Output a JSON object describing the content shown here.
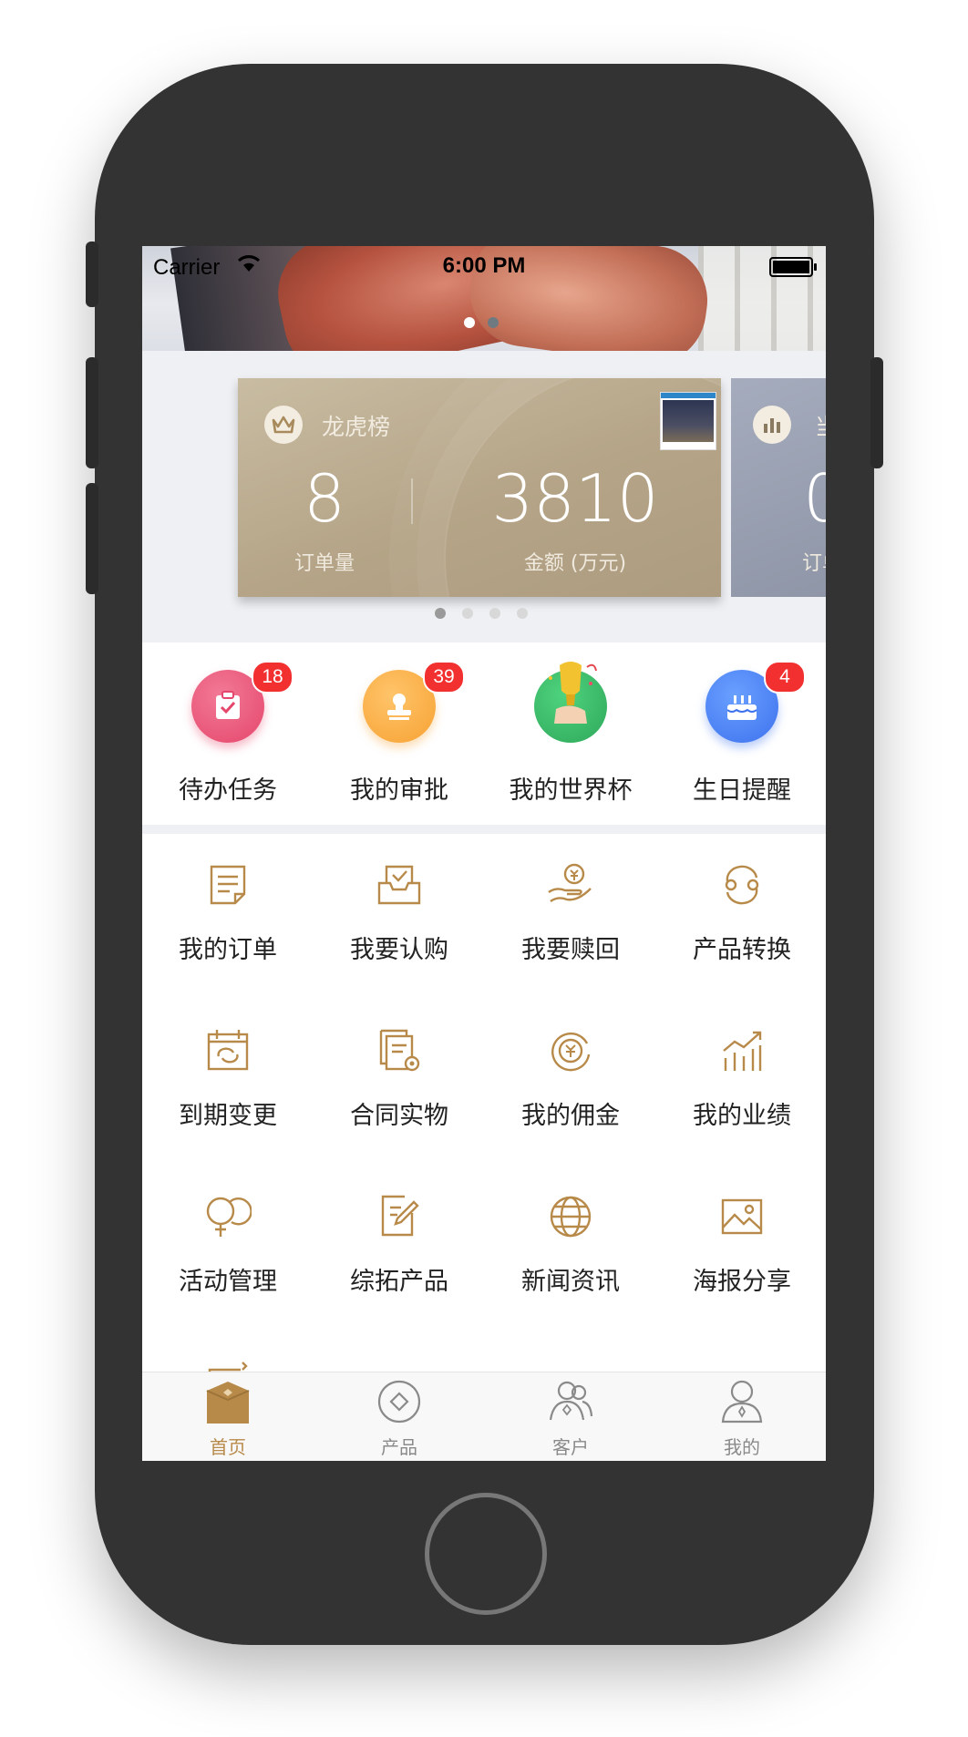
{
  "status_bar": {
    "carrier": "Carrier",
    "time": "6:00 PM"
  },
  "banner": {
    "page_count": 2,
    "active_index": 0
  },
  "rank_card": {
    "title": "龙虎榜",
    "order_count": "8",
    "order_label": "订单量",
    "amount": "3810",
    "amount_label": "金额 (万元)"
  },
  "rank_card_next": {
    "title_fragment": "当",
    "value_fragment": "0",
    "label_fragment": "订单"
  },
  "rank_pager": {
    "page_count": 4,
    "active_index": 0
  },
  "quick_actions": [
    {
      "label": "待办任务",
      "badge": "18",
      "icon": "clipboard-check-icon"
    },
    {
      "label": "我的审批",
      "badge": "39",
      "icon": "stamp-icon"
    },
    {
      "label": "我的世界杯",
      "badge": "",
      "icon": "trophy-icon"
    },
    {
      "label": "生日提醒",
      "badge": "4",
      "icon": "birthday-cake-icon"
    }
  ],
  "grid": [
    {
      "label": "我的订单",
      "icon": "order-document-icon"
    },
    {
      "label": "我要认购",
      "icon": "subscribe-inbox-icon"
    },
    {
      "label": "我要赎回",
      "icon": "redeem-hand-coin-icon"
    },
    {
      "label": "产品转换",
      "icon": "convert-cycle-icon"
    },
    {
      "label": "到期变更",
      "icon": "calendar-change-icon"
    },
    {
      "label": "合同实物",
      "icon": "contract-files-icon"
    },
    {
      "label": "我的佣金",
      "icon": "commission-coin-icon"
    },
    {
      "label": "我的业绩",
      "icon": "performance-chart-icon"
    },
    {
      "label": "活动管理",
      "icon": "balloons-icon"
    },
    {
      "label": "综拓产品",
      "icon": "edit-document-icon"
    },
    {
      "label": "新闻资讯",
      "icon": "globe-icon"
    },
    {
      "label": "海报分享",
      "icon": "picture-icon"
    }
  ],
  "tab_bar": [
    {
      "label": "首页",
      "icon": "home-box-icon",
      "active": true
    },
    {
      "label": "产品",
      "icon": "product-diamond-icon",
      "active": false
    },
    {
      "label": "客户",
      "icon": "customers-icon",
      "active": false
    },
    {
      "label": "我的",
      "icon": "profile-icon",
      "active": false
    }
  ],
  "colors": {
    "phone_body": "#333333",
    "gold_accent": "#b88a4a",
    "badge_red": "#f23030",
    "tab_inactive": "#8a8a8a",
    "page_background": "#eef0f4"
  }
}
